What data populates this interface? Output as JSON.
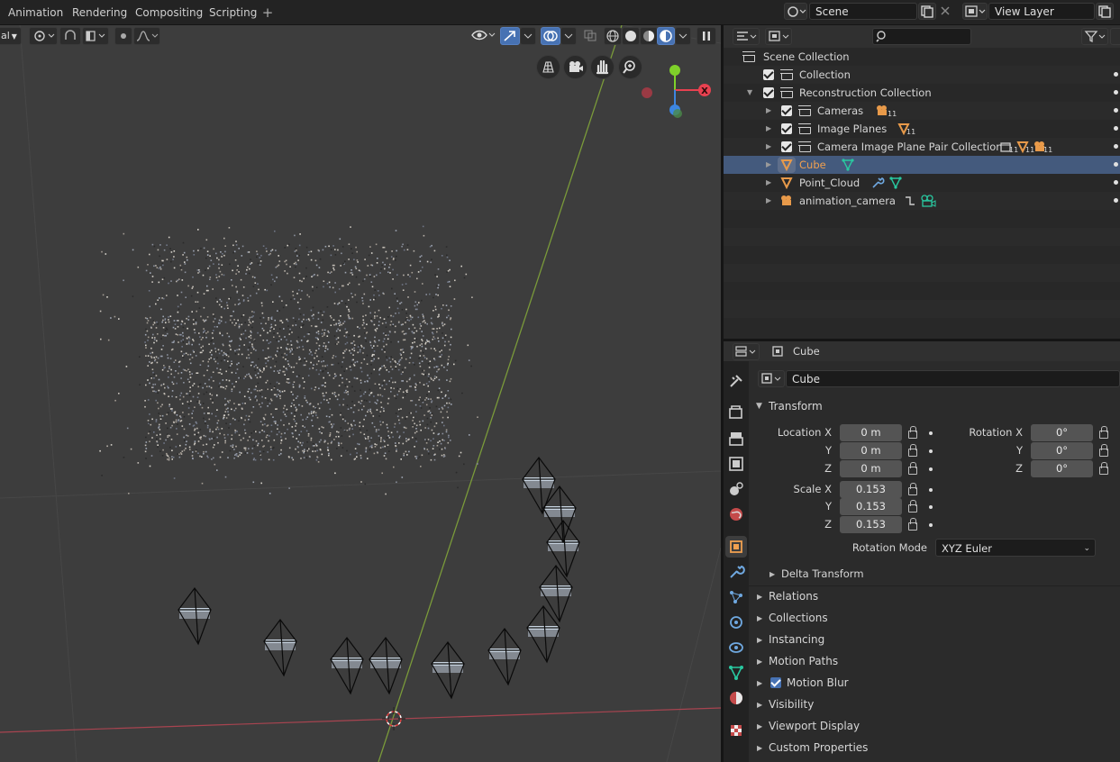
{
  "topbar": {
    "workspace_tabs": [
      "Animation",
      "Rendering",
      "Compositing",
      "Scripting"
    ],
    "add_tab": "+",
    "scene_name": "Scene",
    "view_layer": "View Layer"
  },
  "viewport": {
    "mode_label": "al"
  },
  "outliner": {
    "rows": [
      {
        "label": "Scene Collection"
      },
      {
        "label": "Collection"
      },
      {
        "label": "Reconstruction Collection"
      },
      {
        "label": "Cameras",
        "badge": "11"
      },
      {
        "label": "Image Planes",
        "badge": "11"
      },
      {
        "label": "Camera Image Plane Pair Collection",
        "badges": [
          "11",
          "11",
          "11"
        ]
      },
      {
        "label": "Cube"
      },
      {
        "label": "Point_Cloud"
      },
      {
        "label": "animation_camera"
      }
    ]
  },
  "properties": {
    "header_object": "Cube",
    "object_name": "Cube",
    "transform": {
      "title": "Transform",
      "location_label": "Location X",
      "y_label": "Y",
      "z_label": "Z",
      "location": [
        "0 m",
        "0 m",
        "0 m"
      ],
      "rotation_label": "Rotation X",
      "rotation": [
        "0°",
        "0°",
        "0°"
      ],
      "scale_label": "Scale X",
      "scale": [
        "0.153",
        "0.153",
        "0.153"
      ],
      "rotation_mode_label": "Rotation Mode",
      "rotation_mode": "XYZ Euler",
      "delta": "Delta Transform"
    },
    "panels": [
      "Relations",
      "Collections",
      "Instancing",
      "Motion Paths",
      "Motion Blur",
      "Visibility",
      "Viewport Display",
      "Custom Properties"
    ],
    "motion_blur_checked": true
  },
  "colors": {
    "accent": "#4772b3",
    "selected_row": "#445a7d",
    "object_orange": "#e89a4a",
    "mesh_green": "#29c8a0",
    "axis_x": "#e84150",
    "axis_y": "#7fd12a",
    "axis_z": "#3d86e0"
  }
}
